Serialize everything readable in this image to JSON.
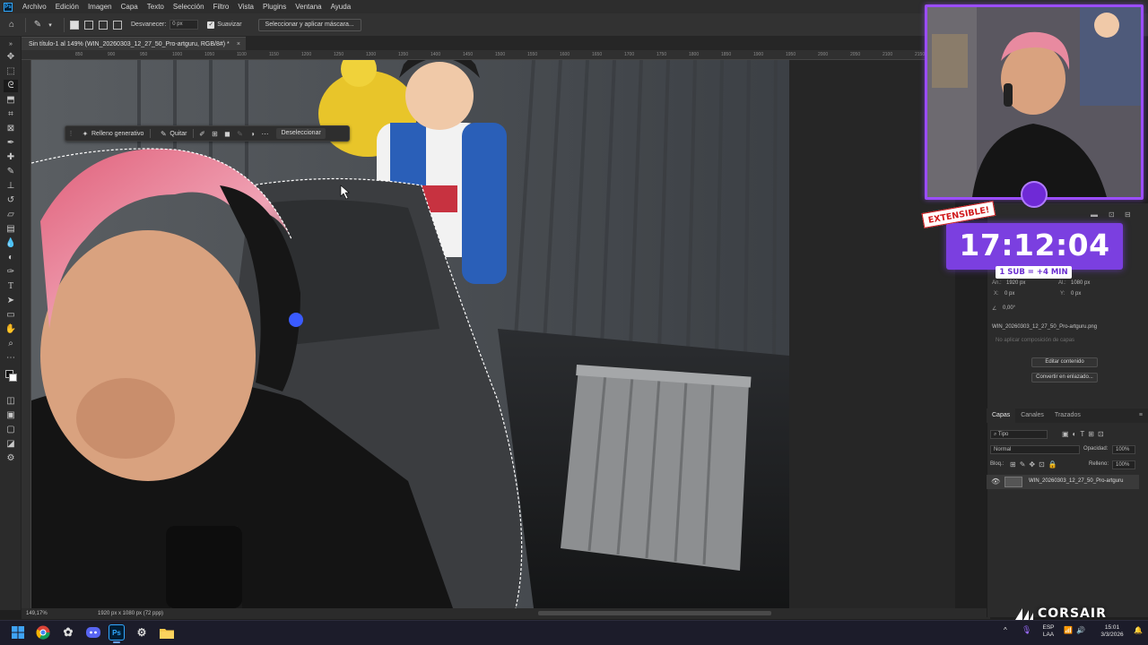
{
  "menu": {
    "items": [
      "Archivo",
      "Edición",
      "Imagen",
      "Capa",
      "Texto",
      "Selección",
      "Filtro",
      "Vista",
      "Plugins",
      "Ventana",
      "Ayuda"
    ]
  },
  "options": {
    "feather_label": "Desvanecer:",
    "feather_value": "0 px",
    "smooth_label": "Suavizar",
    "mask_button": "Seleccionar y aplicar máscara..."
  },
  "document": {
    "tab_title": "Sin título-1 al 149% (WIN_20260303_12_27_50_Pro-artguru, RGB/8#) *",
    "close_glyph": "×",
    "zoom": "149,17%",
    "dimensions": "1920 px x 1080 px (72 ppp)"
  },
  "ruler": {
    "ticks": [
      "850",
      "900",
      "950",
      "1000",
      "1050",
      "1100",
      "1150",
      "1200",
      "1250",
      "1300",
      "1350",
      "1400",
      "1450",
      "1500",
      "1550",
      "1600",
      "1650",
      "1700",
      "1750",
      "1800",
      "1850",
      "1900",
      "1950",
      "2000",
      "2050",
      "2100",
      "2150",
      "2200",
      "2250"
    ]
  },
  "contextual_bar": {
    "generative_fill": "Relleno generativo",
    "remove": "Quitar",
    "deselect": "Deseleccionar"
  },
  "properties": {
    "width_label": "An.:",
    "width_value": "1920 px",
    "height_label": "Al.:",
    "height_value": "1080 px",
    "x_label": "X:",
    "x_value": "0 px",
    "y_label": "Y:",
    "y_value": "0 px",
    "angle_value": "0,00°",
    "filename": "WIN_20260303_12_27_50_Pro-artguru.png",
    "comp_placeholder": "No aplicar composición de capas",
    "edit_contents": "Editar contenido",
    "convert_linked": "Convertir en enlazado..."
  },
  "layers": {
    "tabs": [
      "Capas",
      "Canales",
      "Trazados"
    ],
    "filter_label": "Tipo",
    "blend_mode": "Normal",
    "opacity_label": "Opacidad:",
    "opacity_value": "100%",
    "lock_label": "Bloq.:",
    "fill_label": "Relleno:",
    "fill_value": "100%",
    "layer_name": "WIN_20260303_12_27_50_Pro-artguru"
  },
  "overlay": {
    "extensible": "EXTENSIBLE!",
    "timer": "17:12:04",
    "sub_rule": "1 SUB = +4 MIN",
    "brand": "CORSAIR"
  },
  "taskbar": {
    "lang_top": "ESP",
    "lang_bottom": "LAA",
    "time": "15:01",
    "date": "3/3/2026"
  },
  "colors": {
    "accent_purple": "#9b4dff",
    "timer_bg": "#7b3fe0",
    "extensible_red": "#d0191b",
    "ps_blue": "#31a8ff"
  }
}
